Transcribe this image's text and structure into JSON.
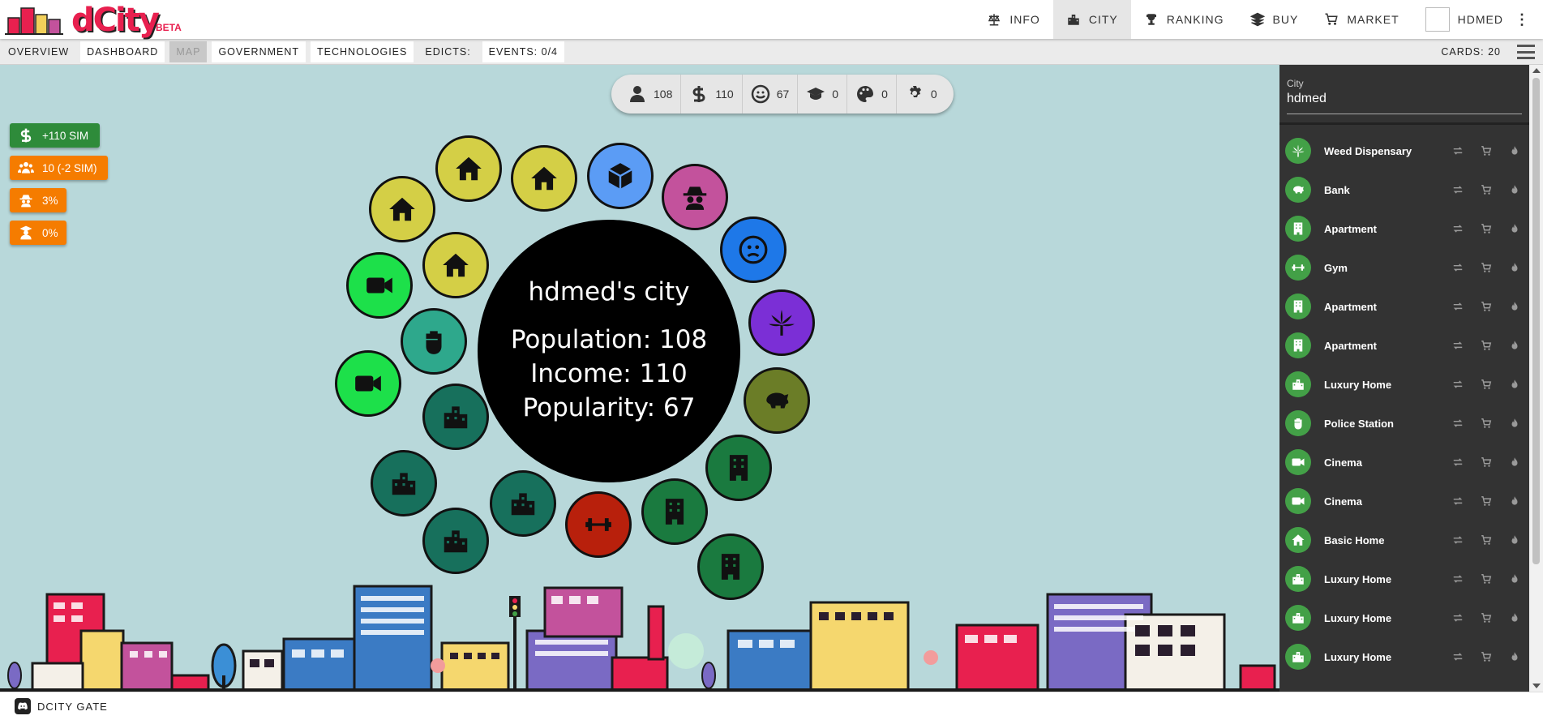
{
  "header": {
    "logo_text": "dCity",
    "beta_label": "BETA",
    "nav": [
      {
        "label": "INFO",
        "icon": "scale-icon"
      },
      {
        "label": "CITY",
        "icon": "city-icon"
      },
      {
        "label": "RANKING",
        "icon": "trophy-icon"
      },
      {
        "label": "BUY",
        "icon": "layers-icon"
      },
      {
        "label": "MARKET",
        "icon": "cart-icon"
      }
    ],
    "user": "HDMED"
  },
  "subbar": {
    "tabs": [
      "OVERVIEW",
      "DASHBOARD",
      "MAP",
      "GOVERNMENT",
      "TECHNOLOGIES"
    ],
    "edicts": "EDICTS:",
    "events": "EVENTS: 0/4",
    "cards": "CARDS: 20"
  },
  "resources": [
    {
      "icon": "person-icon",
      "value": "108"
    },
    {
      "icon": "dollar-icon",
      "value": "110"
    },
    {
      "icon": "smile-icon",
      "value": "67"
    },
    {
      "icon": "graduation-cap-icon",
      "value": "0"
    },
    {
      "icon": "palette-icon",
      "value": "0"
    },
    {
      "icon": "gear-icon",
      "value": "0"
    }
  ],
  "badges": [
    {
      "text": "+110 SIM",
      "color": "#2e8b3a",
      "icon": "dollar-icon"
    },
    {
      "text": "10 (-2 SIM)",
      "color": "#f57c00",
      "icon": "users-icon"
    },
    {
      "text": "3%",
      "color": "#f57c00",
      "icon": "spy-icon"
    },
    {
      "text": "0%",
      "color": "#f57c00",
      "icon": "teacher-icon"
    }
  ],
  "city": {
    "name": "hdmed's city",
    "population": "Population: 108",
    "income": "Income: 110",
    "popularity": "Popularity: 67"
  },
  "bubbles": [
    {
      "icon": "home-icon",
      "color": "#d4cf46"
    },
    {
      "icon": "home-icon",
      "color": "#d4cf46"
    },
    {
      "icon": "home-icon",
      "color": "#d4cf46"
    },
    {
      "icon": "home-icon",
      "color": "#d4cf46"
    },
    {
      "icon": "box-icon",
      "color": "#5b9cf5"
    },
    {
      "icon": "spy-icon",
      "color": "#c3529c"
    },
    {
      "icon": "frown-icon",
      "color": "#1e78e8"
    },
    {
      "icon": "cannabis-icon",
      "color": "#7b2fd6"
    },
    {
      "icon": "piggy-bank-icon",
      "color": "#6b7d27"
    },
    {
      "icon": "building-icon",
      "color": "#1a7a3f"
    },
    {
      "icon": "building-icon",
      "color": "#1a7a3f"
    },
    {
      "icon": "building-icon",
      "color": "#1a7a3f"
    },
    {
      "icon": "dumbbell-icon",
      "color": "#b8200c"
    },
    {
      "icon": "city-icon",
      "color": "#17705c"
    },
    {
      "icon": "city-icon",
      "color": "#17705c"
    },
    {
      "icon": "city-icon",
      "color": "#17705c"
    },
    {
      "icon": "city-icon",
      "color": "#17705c"
    },
    {
      "icon": "fist-icon",
      "color": "#2ea88c"
    },
    {
      "icon": "video-icon",
      "color": "#1de04a"
    },
    {
      "icon": "video-icon",
      "color": "#1de04a"
    }
  ],
  "panel": {
    "label": "City",
    "value": "hdmed",
    "cards": [
      {
        "name": "Weed Dispensary",
        "icon": "cannabis-icon"
      },
      {
        "name": "Bank",
        "icon": "piggy-bank-icon"
      },
      {
        "name": "Apartment",
        "icon": "building-icon"
      },
      {
        "name": "Gym",
        "icon": "dumbbell-icon"
      },
      {
        "name": "Apartment",
        "icon": "building-icon"
      },
      {
        "name": "Apartment",
        "icon": "building-icon"
      },
      {
        "name": "Luxury Home",
        "icon": "city-icon"
      },
      {
        "name": "Police Station",
        "icon": "fist-icon"
      },
      {
        "name": "Cinema",
        "icon": "video-icon"
      },
      {
        "name": "Cinema",
        "icon": "video-icon"
      },
      {
        "name": "Basic Home",
        "icon": "home-icon"
      },
      {
        "name": "Luxury Home",
        "icon": "city-icon"
      },
      {
        "name": "Luxury Home",
        "icon": "city-icon"
      },
      {
        "name": "Luxury Home",
        "icon": "city-icon"
      }
    ]
  },
  "footer": {
    "label": "DCITY GATE"
  }
}
